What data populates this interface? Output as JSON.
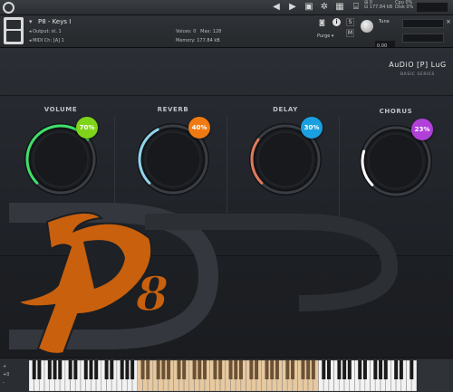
{
  "topbar": {
    "icons": [
      "prev-icon",
      "next-icon",
      "save-icon",
      "gear-icon",
      "grid-icon",
      "browse-icon",
      "view-icon"
    ],
    "stats": {
      "voices_line": "0",
      "mem_line": "177.84 kB",
      "cpu_label": "Cpu",
      "cpu_value": "0%",
      "disk_label": "Disk",
      "disk_value": "0%"
    }
  },
  "header": {
    "title": "P8 - Keys I",
    "output_label": "Output:",
    "output_value": "st. 1",
    "midi_label": "MIDI Ch:",
    "midi_value": "[A]  1",
    "voices_label": "Voices:",
    "voices_value": "0",
    "max_label": "Max:",
    "max_value": "128",
    "memory_label": "Memory:",
    "memory_value": "177.84 kB",
    "purge_label": "Purge",
    "info_label": "i",
    "tune_label": "Tune",
    "tune_value": "0.00",
    "s_label": "S",
    "m_label": "M"
  },
  "brand": {
    "name": "AuDiO [P] LuG",
    "series": "BASIC SERIES"
  },
  "knobs": [
    {
      "label": "VOLUME",
      "value_text": "70%",
      "value": 0.7,
      "color": "#7fd41a",
      "arc": "#3fe06a"
    },
    {
      "label": "REVERB",
      "value_text": "40%",
      "value": 0.4,
      "color": "#f07a12",
      "arc": "#8fd3e8"
    },
    {
      "label": "DELAY",
      "value_text": "30%",
      "value": 0.3,
      "color": "#1aa0e0",
      "arc": "#e07a5a"
    },
    {
      "label": "CHORUS",
      "value_text": "23%",
      "value": 0.23,
      "color": "#b040d8",
      "arc": "#ffffff"
    }
  ],
  "logo": {
    "text": "P8",
    "color": "#c8600e"
  },
  "keyboard": {
    "side_top": "+",
    "side_mid": "+0",
    "side_bot": "-",
    "highlight_color": "#e7c9a0"
  }
}
